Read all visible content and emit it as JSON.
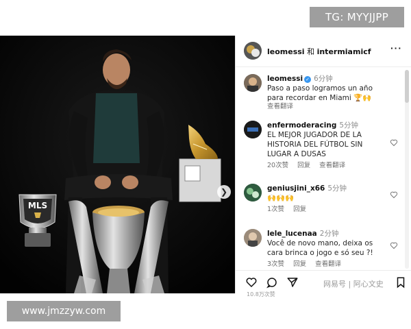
{
  "watermarks": {
    "top_right": "TG: MYYJJPP",
    "bottom_left": "www.jmzzyw.com",
    "site": "网易号 | 阿心文史"
  },
  "photo": {
    "badge_text": "MLS",
    "next_icon": "chevron-right-icon"
  },
  "header": {
    "user1": "leomessi",
    "joiner": "和",
    "user2": "intermiamicf",
    "more_icon": "more-horizontal-icon"
  },
  "comments": [
    {
      "user": "leomessi",
      "verified": true,
      "time": "6分钟",
      "text": "Paso a paso logramos un año para recordar en Miami 🏆🙌",
      "meta": [
        "查看翻译"
      ]
    },
    {
      "user": "enfermoderacing",
      "time": "5分钟",
      "text": "EL MEJOR JUGADOR DE LA HISTORIA DEL FÚTBOL SIN LUGAR A DUSAS",
      "meta": [
        "20次赞",
        "回复",
        "查看翻译"
      ]
    },
    {
      "user": "geniusjini_x66",
      "time": "5分钟",
      "text": "🙌🙌🙌",
      "meta": [
        "1次赞",
        "回复"
      ]
    },
    {
      "user": "lele_lucenaa",
      "time": "2分钟",
      "text": "Você de novo mano, deixa os cara brinca o jogo e só seu ?!",
      "meta": [
        "3次赞",
        "回复",
        "查看翻译"
      ]
    }
  ],
  "actions": {
    "like_icon": "heart-icon",
    "comment_icon": "comment-icon",
    "share_icon": "send-icon",
    "save_icon": "bookmark-icon"
  },
  "cut_text": "10.8万次赞"
}
